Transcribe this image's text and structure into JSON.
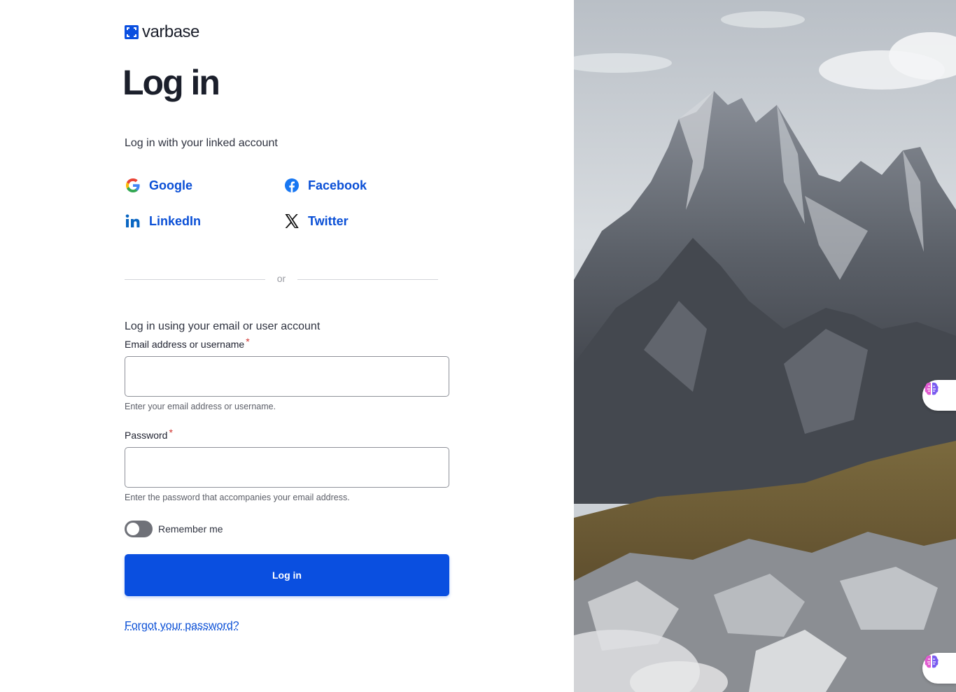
{
  "brand": {
    "name": "varbase",
    "color": "#0a4fe0"
  },
  "page": {
    "title": "Log in"
  },
  "linked": {
    "title": "Log in with your linked account",
    "providers": [
      {
        "label": "Google",
        "icon": "google-icon"
      },
      {
        "label": "Facebook",
        "icon": "facebook-icon"
      },
      {
        "label": "LinkedIn",
        "icon": "linkedin-icon"
      },
      {
        "label": "Twitter",
        "icon": "x-twitter-icon"
      }
    ]
  },
  "divider": {
    "text": "or"
  },
  "form": {
    "title": "Log in using your email or user account",
    "email": {
      "label": "Email address or username",
      "required_mark": "*",
      "value": "",
      "help": "Enter your email address or username."
    },
    "password": {
      "label": "Password",
      "required_mark": "*",
      "value": "",
      "help": "Enter the password that accompanies your email address."
    },
    "remember": {
      "label": "Remember me",
      "checked": false
    },
    "submit_label": "Log in",
    "forgot_label": "Forgot your password?"
  },
  "colors": {
    "link": "#0a4fd6",
    "primary_button": "#0a4fe0",
    "required": "#d0312d"
  },
  "side_image": {
    "subject": "rocky mountain peaks"
  },
  "assistant_buttons": [
    {
      "icon": "brain-icon"
    },
    {
      "icon": "brain-icon"
    }
  ]
}
